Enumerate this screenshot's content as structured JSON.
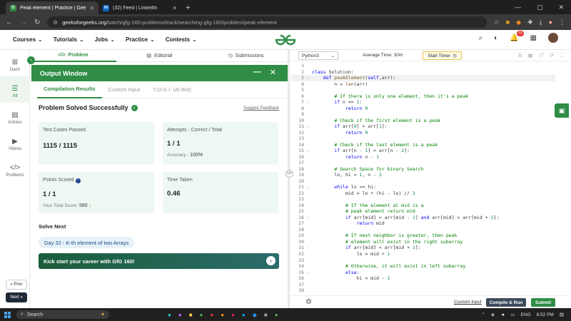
{
  "browser": {
    "tabs": [
      {
        "title": "Peak element | Practice | GeeksforGeeks",
        "favicon": "G",
        "color": "#2f8d46",
        "active": true
      },
      {
        "title": "(32) Feed | LinkedIn",
        "favicon": "in",
        "color": "#0a66c2",
        "active": false
      }
    ],
    "url_domain": "geeksforgeeks.org",
    "url_path": "/batch/gfg-160-problems/track/searching-gfg-160/problem/peak-element"
  },
  "sitenav": {
    "items": [
      "Courses",
      "Tutorials",
      "Jobs",
      "Practice",
      "Contests"
    ],
    "notification_count": "73"
  },
  "rail": {
    "items": [
      {
        "label": "Dash",
        "icon": "grid-icon"
      },
      {
        "label": "All",
        "icon": "list-icon"
      },
      {
        "label": "Articles",
        "icon": "book-icon"
      },
      {
        "label": "Videos",
        "icon": "video-icon"
      },
      {
        "label": "Problems",
        "icon": "code-icon"
      }
    ],
    "prev": "« Prev",
    "next": "Next »"
  },
  "problem_tabs": {
    "problem": "Problem",
    "editorial": "Editorial",
    "submissions": "Submissions"
  },
  "output": {
    "title": "Output Window",
    "tabs": [
      "Compilation Results",
      "Custom Input",
      "Y.O.G.I. (AI Bot)"
    ],
    "status": "Problem Solved Successfully",
    "suggest": "Suggest Feedback",
    "test_cases_label": "Test Cases Passed",
    "test_cases_value": "1115 / 1115",
    "attempts_label": "Attempts : Correct / Total",
    "attempts_value": "1 / 1",
    "accuracy_label": "Accuracy :",
    "accuracy_value": "100%",
    "points_label": "Points Scored",
    "points_value": "1 / 1",
    "total_score_label": "Your Total Score:",
    "total_score_value": "560",
    "time_label": "Time Taken",
    "time_value": "0.46",
    "solve_next": "Solve Next",
    "next_problem": "Day 32 - K-th element of two Arrays",
    "banner": "Kick start your career with GfG 160!"
  },
  "editor": {
    "language": "Python3",
    "avg_time": "Average Time: 30m",
    "timer": "Start Timer",
    "custom_input": "Custom Input",
    "compile_run": "Compile & Run",
    "submit": "Submit"
  },
  "code_lines": [
    "",
    "class Solution:",
    "    def peakElement(self,arr):",
    "        n = len(arr)",
    "",
    "        # If there is only one element, then it's a peak",
    "        if n == 1:",
    "            return 0",
    "",
    "        # Check if the first element is a peak",
    "        if arr[0] > arr[1]:",
    "            return 0",
    "",
    "        # Check if the last element is a peak",
    "        if arr[n - 1] > arr[n - 2]:",
    "            return n - 1",
    "",
    "        # Search Space for binary Search",
    "        lo, hi = 1, n - 2",
    "",
    "        while lo <= hi:",
    "            mid = lo + (hi - lo) // 2",
    "",
    "            # If the element at mid is a",
    "            # peak element return mid",
    "            if arr[mid] > arr[mid - 1] and arr[mid] > arr[mid + 1]:",
    "                return mid",
    "",
    "            # If next neighbor is greater, then peak",
    "            # element will exist in the right subarray",
    "            if arr[mid] < arr[mid + 1]:",
    "                lo = mid + 1",
    "",
    "            # Otherwise, it will exist in left subarray",
    "            else:",
    "                hi = mid - 1",
    "",
    ""
  ],
  "fold_lines": [
    3,
    7,
    11,
    15,
    21,
    26,
    31,
    35
  ],
  "taskbar": {
    "search": "Search",
    "language": "ENG",
    "time": "8:52 PM"
  }
}
